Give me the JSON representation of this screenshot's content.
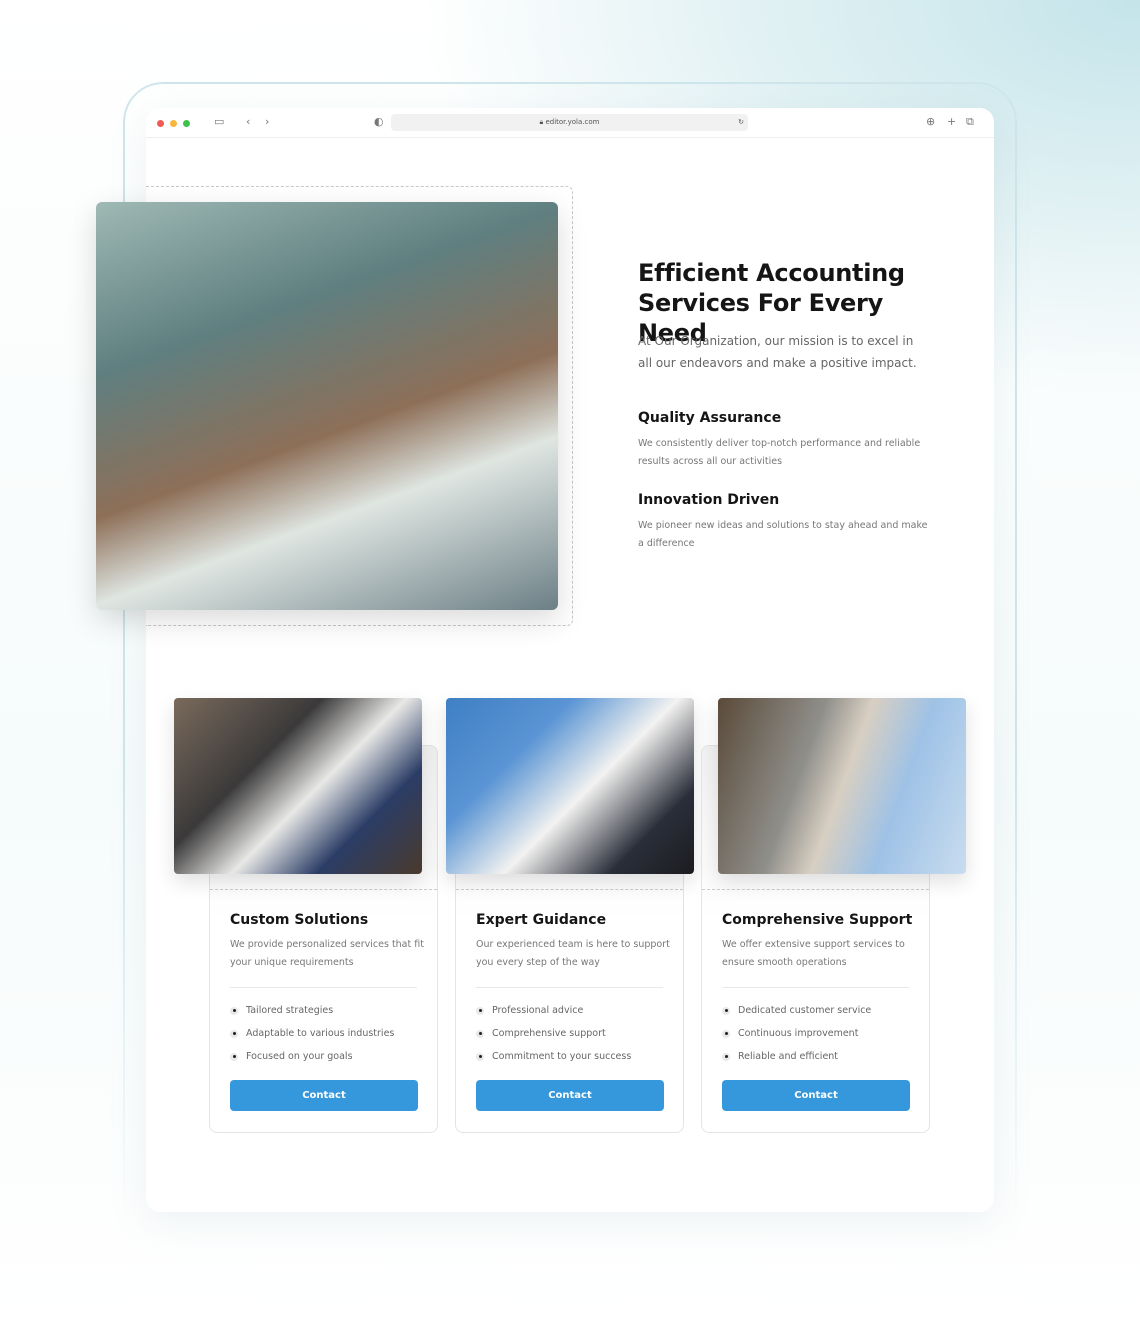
{
  "browser": {
    "url": "editor.yola.com",
    "dots": [
      "#f05a55",
      "#f6b73c",
      "#3ec14b"
    ]
  },
  "hero": {
    "title": "Efficient Accounting Services For Every Need",
    "description": "At Our Organization, our mission is to excel in all our endeavors and make a positive impact.",
    "features": [
      {
        "title": "Quality Assurance",
        "description": "We consistently deliver top-notch performance and reliable results across all our activities"
      },
      {
        "title": "Innovation Driven",
        "description": "We pioneer new ideas and solutions to stay ahead and make a difference"
      }
    ]
  },
  "cards": [
    {
      "title": "Custom Solutions",
      "description": "We provide personalized services that fit your unique requirements",
      "items": [
        "Tailored strategies",
        "Adaptable to various industries",
        "Focused on your goals"
      ],
      "button": "Contact"
    },
    {
      "title": "Expert Guidance",
      "description": "Our experienced team is here to support you every step of the way",
      "items": [
        "Professional advice",
        "Comprehensive support",
        "Commitment to your success"
      ],
      "button": "Contact"
    },
    {
      "title": "Comprehensive Support",
      "description": "We offer extensive support services to ensure smooth operations",
      "items": [
        "Dedicated customer service",
        "Continuous improvement",
        "Reliable and efficient"
      ],
      "button": "Contact"
    }
  ],
  "colors": {
    "accent": "#3598dc"
  }
}
